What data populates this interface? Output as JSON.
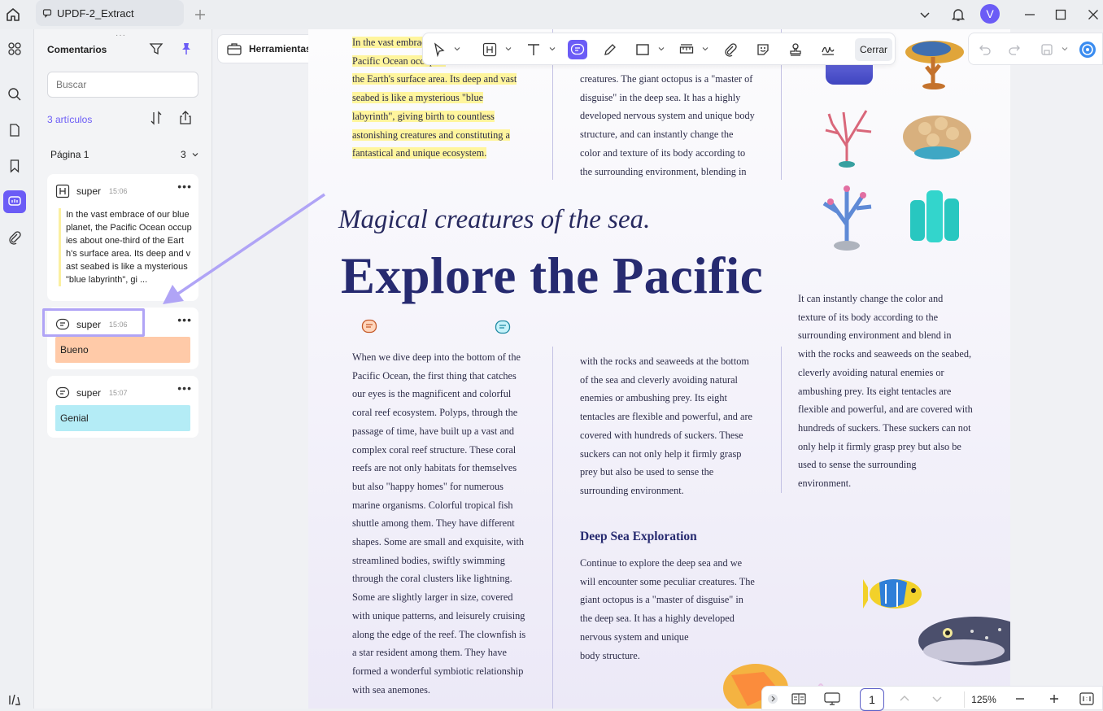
{
  "window": {
    "tab_title": "UPDF-2_Extract",
    "avatar_initial": "V"
  },
  "toolbar": {
    "tools_label": "Herramientas",
    "close_label": "Cerrar"
  },
  "sidebar": {
    "title": "Comentarios",
    "search_placeholder": "Buscar",
    "count_label": "3 artículos",
    "page_label": "Página 1",
    "page_count": "3",
    "comments": [
      {
        "user": "super",
        "time": "15:06",
        "text": "In the vast embrace of our blue planet, the Pacific Ocean occupies about one-third of the Earth's surface area. Its deep and vast seabed is like a mysterious \"blue labyrinth\", gi ..."
      },
      {
        "user": "super",
        "time": "15:06",
        "text": "Bueno",
        "color": "#ffcaa8"
      },
      {
        "user": "super",
        "time": "15:07",
        "text": "Genial",
        "color": "#b4ecf6"
      }
    ]
  },
  "document": {
    "col1_top": [
      "In the vast embrace",
      "Pacific Ocean occupies",
      "the Earth's surface area. Its deep and vast",
      "seabed is like a mysterious \"blue",
      "labyrinth\", giving birth to countless",
      "astonishing creatures and constituting a",
      "fantastical and unique ecosystem."
    ],
    "col2_top": [
      "creatures. The giant octopus is a \"master of",
      "disguise\" in the deep sea. It has a highly",
      "developed nervous system and unique body",
      "structure, and can instantly change the",
      "color and texture of its body according to",
      "the surrounding environment, blending in"
    ],
    "subtitle": "Magical creatures of the sea.",
    "title": "Explore the Pacific",
    "col1": [
      "When we dive deep into the bottom of the",
      "Pacific Ocean, the first thing that catches",
      "our eyes is the magnificent and colorful",
      "coral reef ecosystem. Polyps, through the",
      "passage of time, have built up a vast and",
      "complex coral reef structure. These coral",
      "reefs are not only habitats for themselves",
      "but also \"happy homes\" for numerous",
      "marine organisms. Colorful tropical fish",
      "shuttle among them. They have different",
      "shapes. Some are small and exquisite, with",
      "streamlined bodies, swiftly swimming",
      "through the coral clusters like lightning.",
      "Some are slightly larger in size, covered",
      "with unique patterns, and leisurely cruising",
      "along the edge of the reef. The clownfish is",
      "a star resident among them. They have",
      "formed a wonderful symbiotic relationship",
      "with sea anemones."
    ],
    "col2": [
      "with the rocks and seaweeds at the bottom",
      "of the sea and cleverly avoiding natural",
      "enemies or ambushing prey. Its eight",
      "tentacles are flexible and powerful, and are",
      "covered with hundreds of suckers. These",
      "suckers can not only help it firmly grasp",
      "prey but also be used to sense the",
      "surrounding environment."
    ],
    "section_heading": "Deep Sea Exploration",
    "col2b": [
      "Continue to explore the deep sea and we",
      "will encounter some peculiar creatures. The",
      "giant octopus is a \"master of disguise\" in",
      "the deep sea. It has a highly developed",
      "nervous system and unique",
      "body structure."
    ],
    "col3": [
      "It can instantly change the color and",
      "texture of its body according to the",
      "surrounding environment and blend in",
      "with the rocks and seaweeds on the seabed,",
      "cleverly avoiding natural enemies or",
      "ambushing prey. Its eight tentacles are",
      "flexible and powerful, and are covered with",
      "hundreds of suckers. These suckers can not",
      "only help it firmly grasp prey but also be",
      "used to sense the surrounding",
      "environment."
    ]
  },
  "bottom_bar": {
    "page": "1",
    "zoom": "125%"
  },
  "colors": {
    "accent": "#6b5cf6",
    "title": "#262a70",
    "highlight": "#fff59d"
  }
}
